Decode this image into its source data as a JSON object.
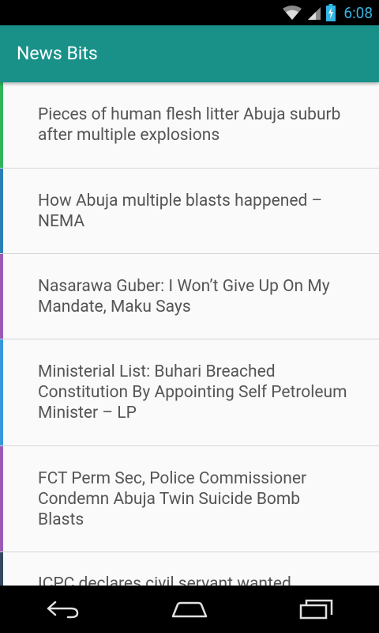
{
  "status_bar": {
    "time": "6:08"
  },
  "app": {
    "title": "News Bits"
  },
  "news_items": [
    {
      "title": "Pieces of human flesh litter Abuja suburb after multiple explosions",
      "accent_color": "#2fb45a"
    },
    {
      "title": "How Abuja multiple blasts happened – NEMA",
      "accent_color": "#2b7fb8"
    },
    {
      "title": "Nasarawa Guber: I Won’t Give Up On My Mandate, Maku Says",
      "accent_color": "#9b59b6"
    },
    {
      "title": "Ministerial List: Buhari Breached Constitution By Appointing Self Petroleum Minister – LP",
      "accent_color": "#3598db"
    },
    {
      "title": "FCT Perm Sec, Police Commissioner Condemn Abuja Twin Suicide Bomb Blasts",
      "accent_color": "#9b59b6"
    },
    {
      "title": "ICPC declares civil servant wanted",
      "accent_color": "#34495e"
    }
  ],
  "nav": {
    "back_icon": "back-icon",
    "home_icon": "home-icon",
    "recents_icon": "recents-icon"
  }
}
